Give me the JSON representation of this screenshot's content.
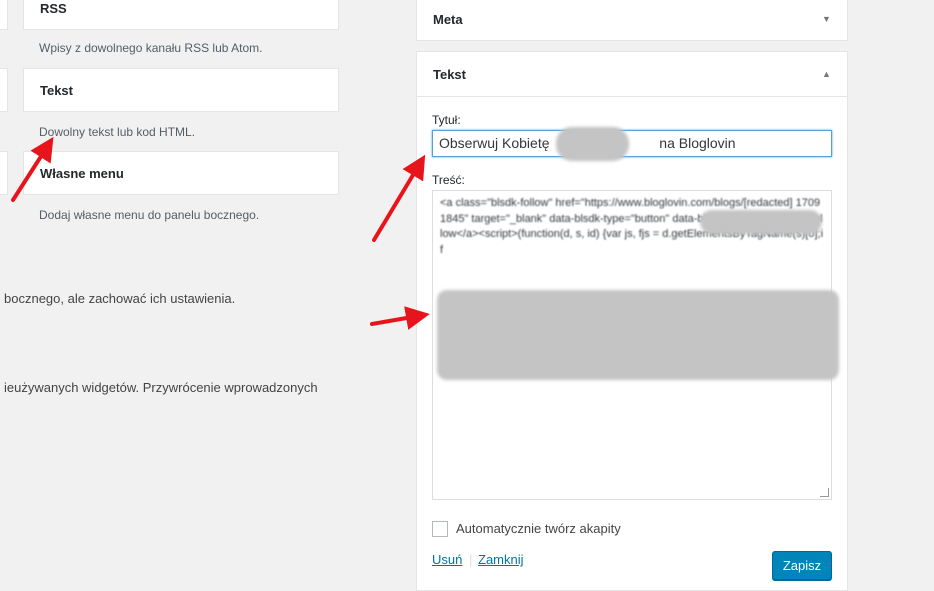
{
  "available_widgets": {
    "rss": {
      "title": "RSS",
      "desc": "Wpisy z dowolnego kanału RSS lub Atom."
    },
    "tekst": {
      "title": "Tekst",
      "desc": "Dowolny tekst lub kod HTML."
    },
    "menu": {
      "title": "Własne menu",
      "desc": "Dodaj własne menu do panelu bocznego."
    }
  },
  "inactive_text_1": "bocznego, ale zachować ich ustawienia.",
  "inactive_text_2": "ieużywanych widgetów. Przywrócenie wprowadzonych",
  "sidebar": {
    "meta_title": "Meta",
    "tekst_title": "Tekst",
    "title_label": "Tytuł:",
    "title_value": "Obserwuj Kobietę [redacted] na Bloglovin",
    "title_visible_start": "Obserwuj Kobietę",
    "title_visible_end": "na Bloglovin",
    "content_label": "Treść:",
    "content_value": "<a class=\"blsdk-follow\" href=\"https://www.bloglovin.com/blogs/[redacted] 17091845\" target=\"_blank\" data-blsdk-type=\"button\" data-blsdk-counter=\"false\">Follow</a><script>(function(d, s, id) {var js, fjs = d.getElementsByTagName(s)[0];if",
    "checkbox_label": "Automatycznie twórz akapity",
    "delete_link": "Usuń",
    "separator": "|",
    "close_link": "Zamknij",
    "save_button": "Zapisz"
  },
  "colors": {
    "accent": "#0085ba",
    "link": "#0073aa",
    "annotation_arrow": "#e8141b"
  }
}
